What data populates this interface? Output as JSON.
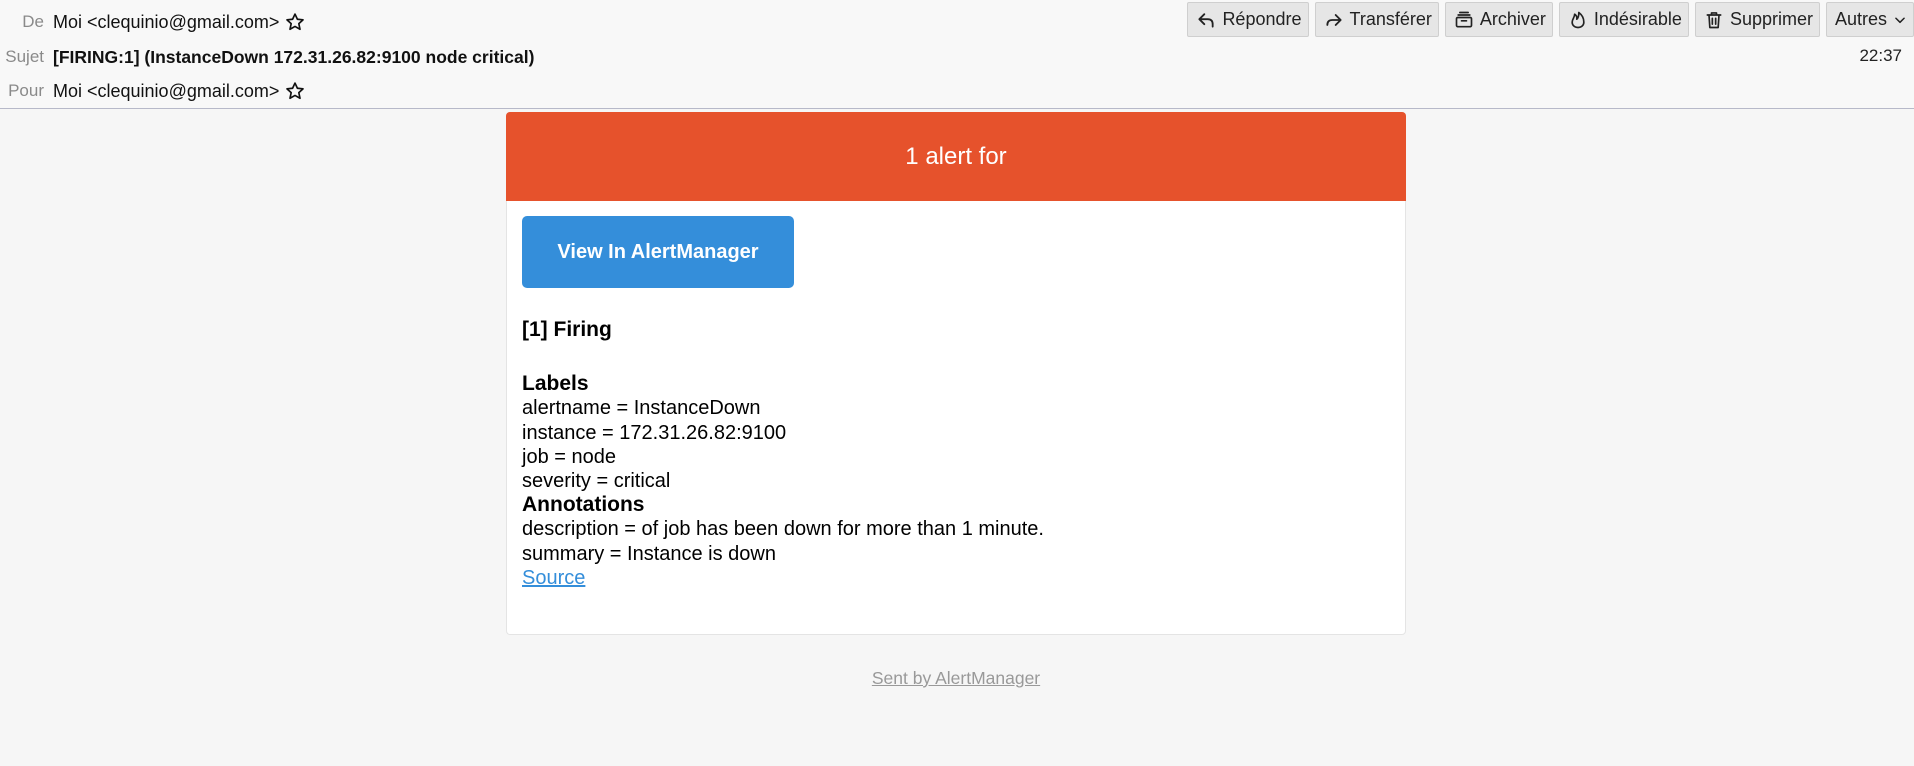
{
  "header": {
    "from_label": "De",
    "from_value": "Moi <clequinio@gmail.com>",
    "subject_label": "Sujet",
    "subject_value": "[FIRING:1] (InstanceDown 172.31.26.82:9100 node critical)",
    "to_label": "Pour",
    "to_value": "Moi <clequinio@gmail.com>",
    "time": "22:37"
  },
  "toolbar": {
    "reply": "Répondre",
    "forward": "Transférer",
    "archive": "Archiver",
    "junk": "Indésirable",
    "delete": "Supprimer",
    "more": "Autres"
  },
  "email": {
    "banner": "1 alert for",
    "cta": "View In AlertManager",
    "firing": "[1] Firing",
    "labels_heading": "Labels",
    "labels": [
      "alertname = InstanceDown",
      "instance = 172.31.26.82:9100",
      "job = node",
      "severity = critical"
    ],
    "annotations_heading": "Annotations",
    "annotations": [
      "description = of job has been down for more than 1 minute.",
      "summary = Instance is down"
    ],
    "source_link": "Source",
    "footer": "Sent by AlertManager"
  },
  "colors": {
    "banner": "#e6522c",
    "button": "#348eda",
    "link": "#348eda"
  },
  "icons": [
    "star-icon",
    "reply-icon",
    "forward-icon",
    "archive-icon",
    "flame-icon",
    "trash-icon",
    "chevron-down-icon"
  ]
}
